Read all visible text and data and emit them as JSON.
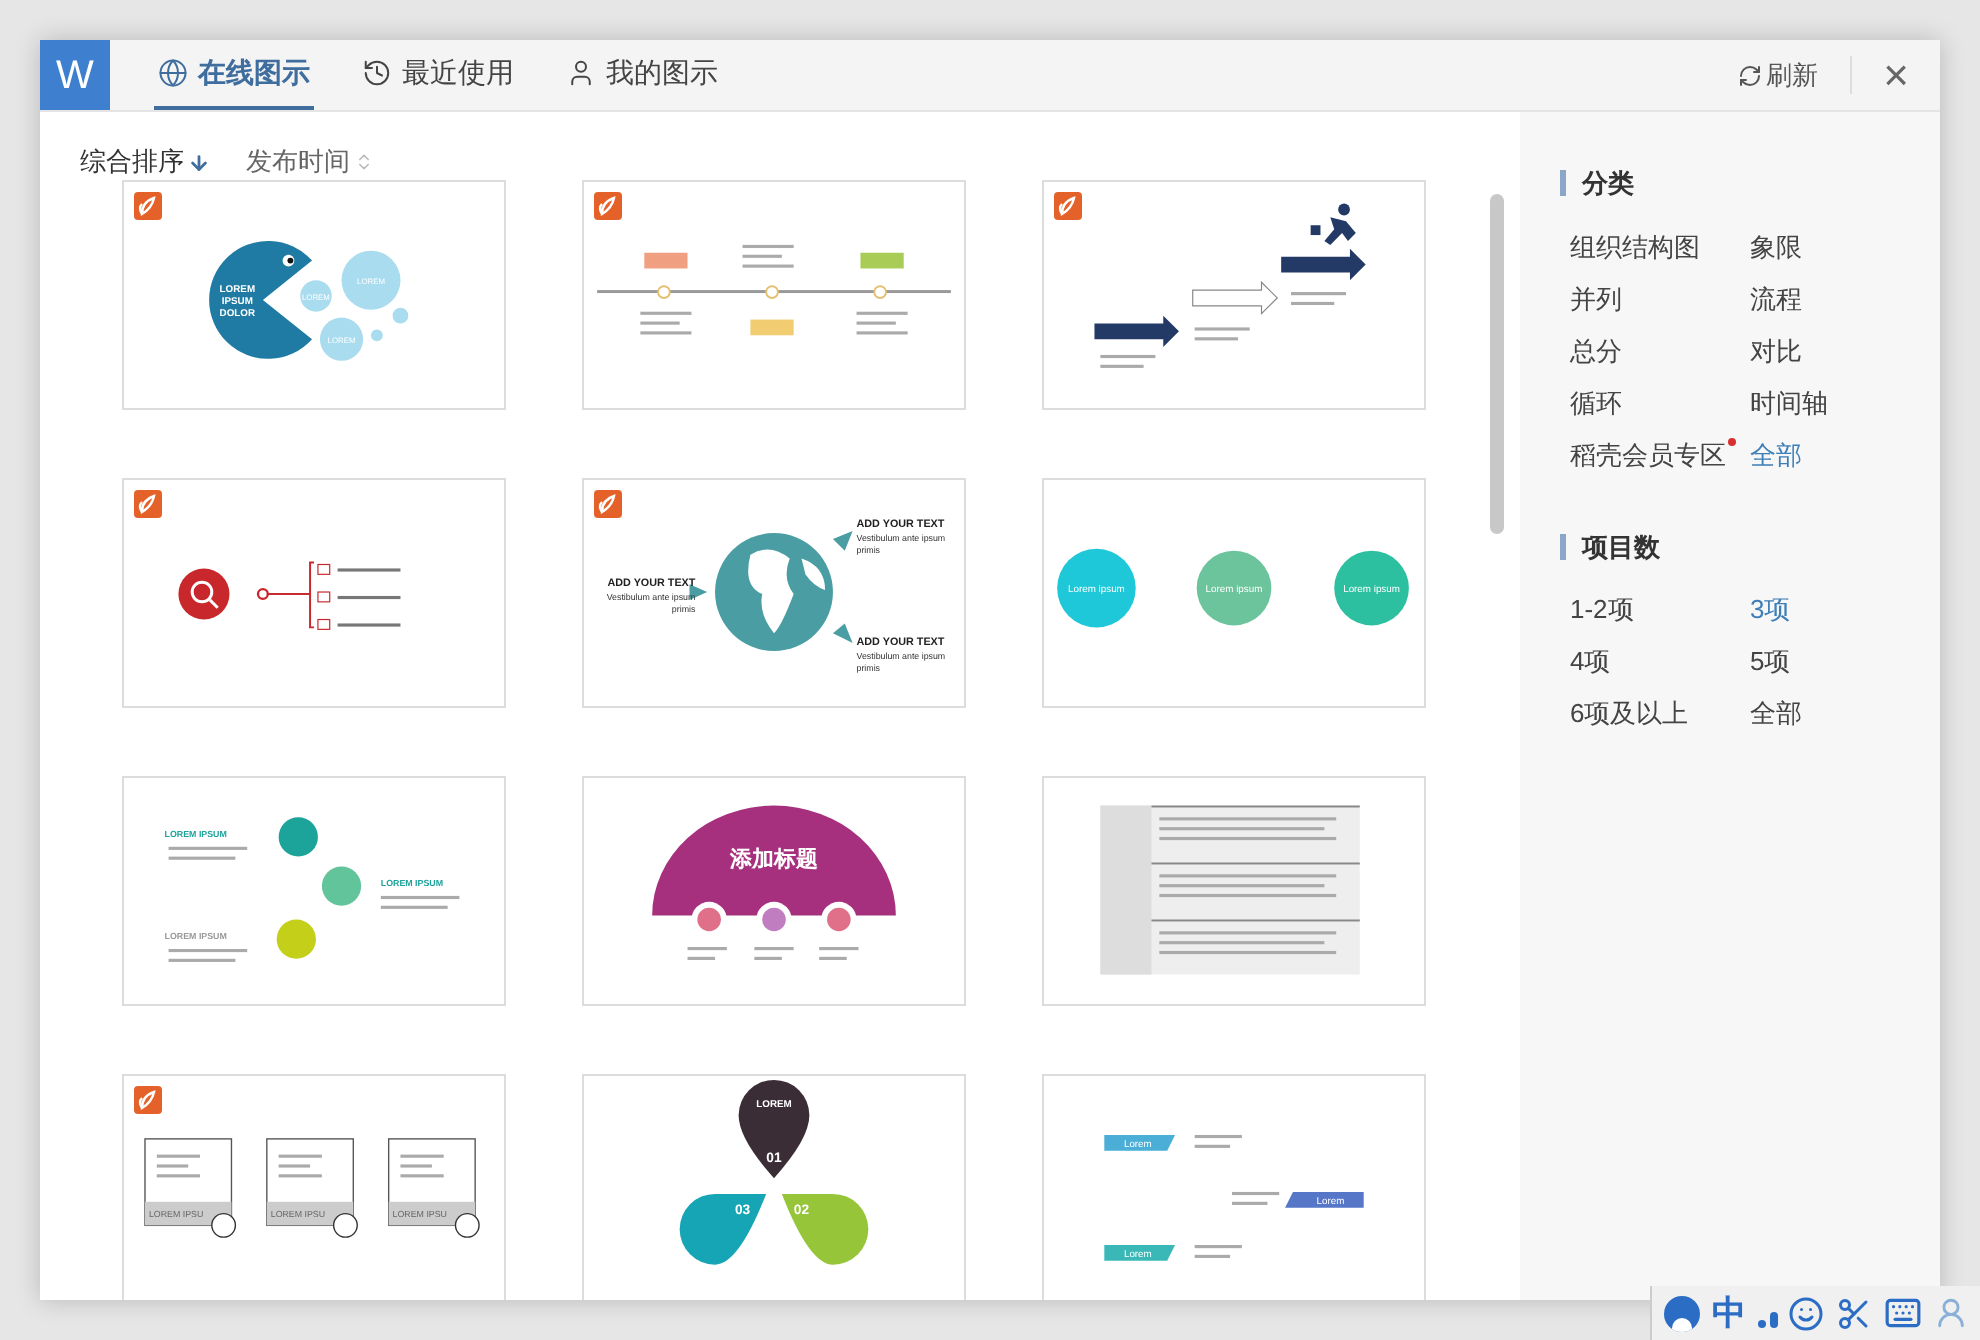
{
  "window": {
    "logo": "W",
    "refresh": "刷新",
    "close": "×"
  },
  "tabs": [
    {
      "label": "在线图示",
      "kind": "globe",
      "selected": true
    },
    {
      "label": "最近使用",
      "kind": "history",
      "selected": false
    },
    {
      "label": "我的图示",
      "kind": "user",
      "selected": false
    }
  ],
  "sort": [
    {
      "label": "综合排序",
      "selected": true
    },
    {
      "label": "发布时间",
      "selected": false
    }
  ],
  "thumbnails": [
    {
      "kind": "pacman",
      "badge": true,
      "texts": [
        "LOREM",
        "IPSUM",
        "DOLOR",
        "LOREM",
        "LOREM",
        "LOREM"
      ]
    },
    {
      "kind": "timeline",
      "badge": true
    },
    {
      "kind": "arrows",
      "badge": true
    },
    {
      "kind": "magnifier",
      "badge": true
    },
    {
      "kind": "globe",
      "badge": true,
      "texts": [
        "ADD YOUR TEXT",
        "Vestibulum ante ipsum",
        "primis",
        "ADD YOUR TEXT",
        "Vestibulum ante ipsum",
        "primis",
        "ADD YOUR TEXT",
        "Vestibulum ante ipsum",
        "primis"
      ]
    },
    {
      "kind": "circles",
      "badge": false,
      "texts": [
        "Lorem ipsum",
        "Lorem ipsum",
        "Lorem ipsum"
      ]
    },
    {
      "kind": "steps",
      "badge": false,
      "texts": [
        "LOREM IPSUM",
        "LOREM IPSUM",
        "LOREM IPSUM"
      ]
    },
    {
      "kind": "arc",
      "badge": false,
      "texts": [
        "添加标题"
      ]
    },
    {
      "kind": "table",
      "badge": false
    },
    {
      "kind": "cards",
      "badge": true,
      "texts": [
        "LOREM IPSU",
        "LOREM IPSU",
        "LOREM IPSU"
      ]
    },
    {
      "kind": "pins",
      "badge": false,
      "texts": [
        "LOREM",
        "01",
        "03",
        "02"
      ]
    },
    {
      "kind": "ribbons",
      "badge": false,
      "texts": [
        "Lorem",
        "Lorem",
        "Lorem"
      ]
    }
  ],
  "sidebar": {
    "sections": [
      {
        "title": "分类",
        "items": [
          {
            "label": "组织结构图",
            "selected": false,
            "dot": false
          },
          {
            "label": "象限",
            "selected": false,
            "dot": false
          },
          {
            "label": "并列",
            "selected": false,
            "dot": false
          },
          {
            "label": "流程",
            "selected": false,
            "dot": false
          },
          {
            "label": "总分",
            "selected": false,
            "dot": false
          },
          {
            "label": "对比",
            "selected": false,
            "dot": false
          },
          {
            "label": "循环",
            "selected": false,
            "dot": false
          },
          {
            "label": "时间轴",
            "selected": false,
            "dot": false
          },
          {
            "label": "稻壳会员专区",
            "selected": false,
            "dot": true
          },
          {
            "label": "全部",
            "selected": true,
            "dot": false
          }
        ]
      },
      {
        "title": "项目数",
        "items": [
          {
            "label": "1-2项",
            "selected": false,
            "dot": false
          },
          {
            "label": "3项",
            "selected": true,
            "dot": false
          },
          {
            "label": "4项",
            "selected": false,
            "dot": false
          },
          {
            "label": "5项",
            "selected": false,
            "dot": false
          },
          {
            "label": "6项及以上",
            "selected": false,
            "dot": false
          },
          {
            "label": "全部",
            "selected": false,
            "dot": false
          }
        ]
      }
    ]
  },
  "taskbar": [
    {
      "kind": "avatar"
    },
    {
      "kind": "text",
      "label": "中"
    },
    {
      "kind": "punct"
    },
    {
      "kind": "smile"
    },
    {
      "kind": "scissors"
    },
    {
      "kind": "keyboard"
    },
    {
      "kind": "user"
    }
  ]
}
